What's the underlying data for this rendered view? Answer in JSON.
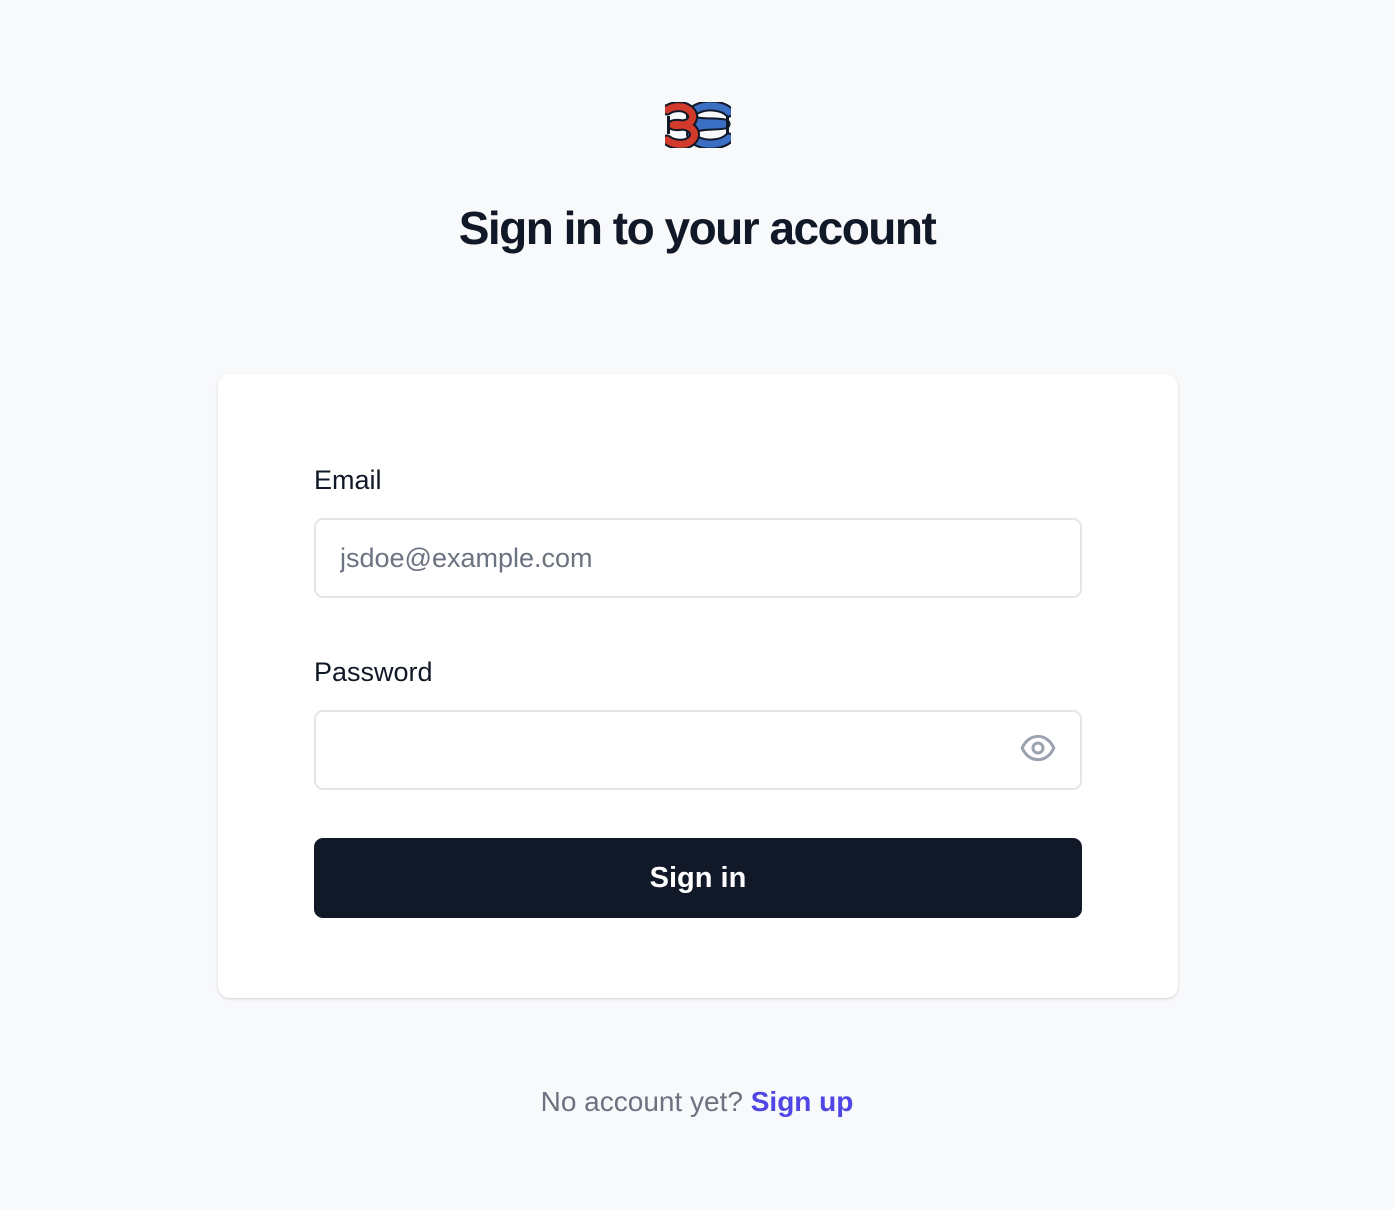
{
  "header": {
    "logo_icon": "knot-logo-icon",
    "title": "Sign in to your account"
  },
  "form": {
    "email_label": "Email",
    "email_placeholder": "jsdoe@example.com",
    "email_value": "",
    "password_label": "Password",
    "password_value": "",
    "show_password_icon": "eye-icon",
    "submit_label": "Sign in"
  },
  "footer": {
    "prompt": "No account yet?",
    "signup_label": "Sign up"
  },
  "colors": {
    "background": "#f8f9fb",
    "button": "#111827",
    "link": "#4f46e5",
    "logo_red": "#d23a2c",
    "logo_blue": "#3b6fc4"
  }
}
